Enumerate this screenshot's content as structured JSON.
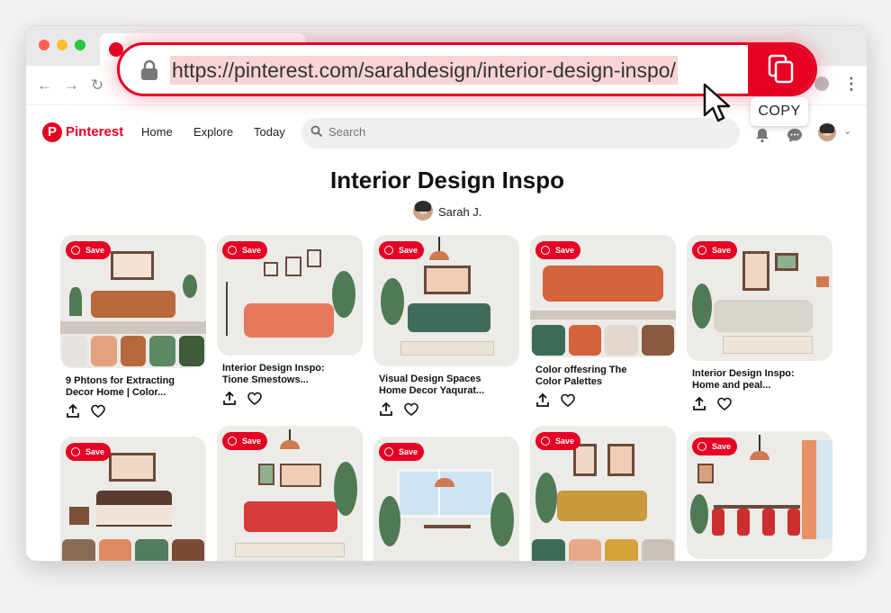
{
  "browser": {
    "url": "https://pinterest.com/sarahdesign/interior-design-inspo/",
    "copy_tooltip": "COPY",
    "colors": {
      "accent": "#e60023",
      "url_highlight": "#f8d4d4"
    }
  },
  "header": {
    "brand": "Pinterest",
    "nav": [
      "Home",
      "Explore",
      "Today"
    ],
    "search_placeholder": "Search"
  },
  "board": {
    "title": "Interior Design Inspo",
    "owner": "Sarah J."
  },
  "pins": [
    {
      "save_label": "Save",
      "title_1": "9 Phtons for Extracting",
      "title_2": "Decor Home | Color..."
    },
    {
      "save_label": "Save",
      "title_1": "Interior Design Inspo:",
      "title_2": "Tione Smestows..."
    },
    {
      "save_label": "Save",
      "title_1": "Visual Design Spaces",
      "title_2": "Home Decor Yaqurat..."
    },
    {
      "save_label": "Save",
      "title_1": "Color offesring The",
      "title_2": "Color Palettes"
    },
    {
      "save_label": "Save",
      "title_1": "Interior Design Inspo:",
      "title_2": "Home and peal..."
    },
    {
      "save_label": "Save"
    },
    {
      "save_label": "Save"
    },
    {
      "save_label": "Save"
    },
    {
      "save_label": "Save"
    },
    {
      "save_label": "Save"
    }
  ]
}
